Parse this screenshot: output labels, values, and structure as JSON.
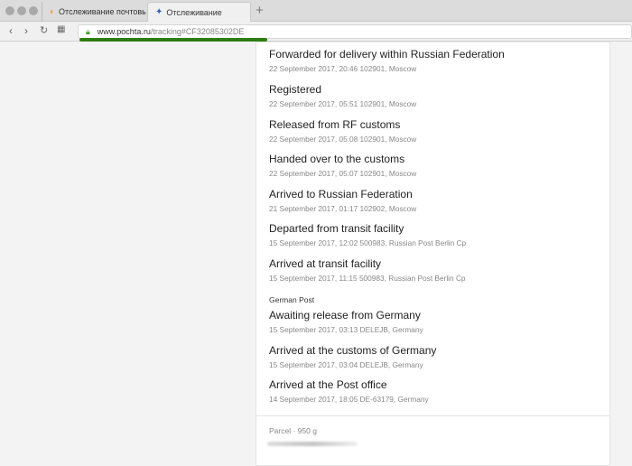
{
  "browser": {
    "tabs": [
      {
        "label": "Отслеживание почтовых от",
        "icon": "aliexpress-icon"
      },
      {
        "label": "Отслеживание",
        "icon": "pochta-eagle-icon",
        "active": true
      }
    ],
    "url_host": "www.pochta.ru",
    "url_path": "/tracking#CF32085302DE",
    "load_progress": 0.35
  },
  "events": [
    {
      "title": "Forwarded for delivery within Russian Federation",
      "sub": "22 September 2017, 20:46 102901, Moscow"
    },
    {
      "title": "Registered",
      "sub": "22 September 2017, 05:51 102901, Moscow"
    },
    {
      "title": "Released from RF customs",
      "sub": "22 September 2017, 05:08 102901, Moscow"
    },
    {
      "title": "Handed over to the customs",
      "sub": "22 September 2017, 05:07 102901, Moscow"
    },
    {
      "title": "Arrived to Russian Federation",
      "sub": "21 September 2017, 01:17 102902, Moscow"
    },
    {
      "title": "Departed from transit facility",
      "sub": "15 September 2017, 12:02 500983, Russian Post Berlin Cp"
    },
    {
      "title": "Arrived at transit facility",
      "sub": "15 September 2017, 11:15 500983, Russian Post Berlin Cp"
    },
    {
      "title": "Awaiting release from Germany",
      "sub": "15 September 2017, 03:13 DELEJB, Germany"
    },
    {
      "title": "Arrived at the customs of Germany",
      "sub": "15 September 2017, 03:04 DELEJB, Germany"
    },
    {
      "title": "Arrived at the Post office",
      "sub": "14 September 2017, 18:05 DE-63179, Germany"
    }
  ],
  "group_label": "German Post",
  "parcel": "Parcel  ·  950 g"
}
